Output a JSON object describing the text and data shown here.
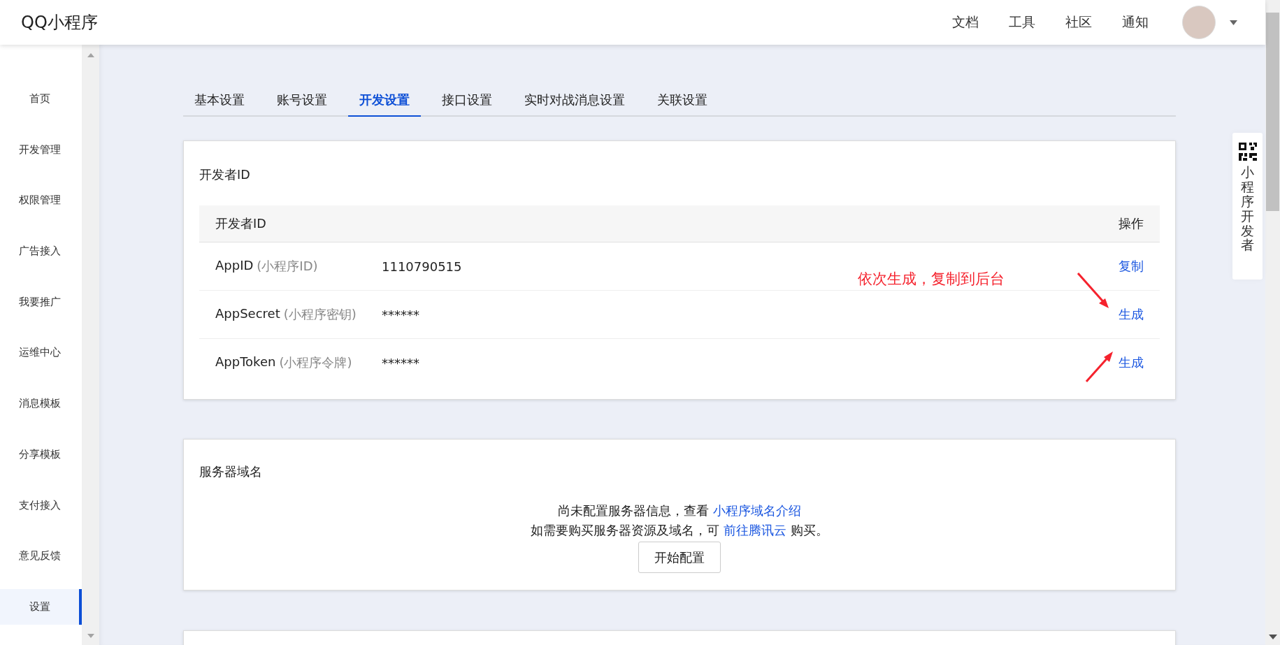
{
  "header": {
    "logo": "QQ小程序",
    "nav": [
      {
        "label": "文档"
      },
      {
        "label": "工具"
      },
      {
        "label": "社区"
      },
      {
        "label": "通知"
      }
    ]
  },
  "sidebar": {
    "items": [
      {
        "label": "首页",
        "selected": false
      },
      {
        "label": "开发管理",
        "selected": false
      },
      {
        "label": "权限管理",
        "selected": false
      },
      {
        "label": "广告接入",
        "selected": false
      },
      {
        "label": "我要推广",
        "selected": false
      },
      {
        "label": "运维中心",
        "selected": false
      },
      {
        "label": "消息模板",
        "selected": false
      },
      {
        "label": "分享模板",
        "selected": false
      },
      {
        "label": "支付接入",
        "selected": false
      },
      {
        "label": "意见反馈",
        "selected": false
      },
      {
        "label": "设置",
        "selected": true
      }
    ]
  },
  "tabs": [
    {
      "label": "基本设置",
      "selected": false
    },
    {
      "label": "账号设置",
      "selected": false
    },
    {
      "label": "开发设置",
      "selected": true
    },
    {
      "label": "接口设置",
      "selected": false
    },
    {
      "label": "实时对战消息设置",
      "selected": false
    },
    {
      "label": "关联设置",
      "selected": false
    }
  ],
  "developer_id": {
    "title": "开发者ID",
    "columns": [
      "开发者ID",
      "操作"
    ],
    "rows": [
      {
        "name": "AppID",
        "hint": "(小程序ID)",
        "value": "1110790515",
        "action": "复制"
      },
      {
        "name": "AppSecret",
        "hint": "(小程序密钥)",
        "value": "******",
        "action": "生成"
      },
      {
        "name": "AppToken",
        "hint": "(小程序令牌)",
        "value": "******",
        "action": "生成"
      }
    ],
    "annotation": {
      "text": "依次生成，复制到后台"
    }
  },
  "server_domain": {
    "title": "服务器域名",
    "lines": [
      {
        "text": "尚未配置服务器信息，查看 ",
        "link": "小程序域名介绍"
      },
      {
        "text": "如需要购买服务器资源及域名，可 ",
        "link": "前往腾讯云",
        "after": " 购买。"
      }
    ],
    "button": "开始配置"
  },
  "float_panel": {
    "label": "小程序开发者"
  }
}
